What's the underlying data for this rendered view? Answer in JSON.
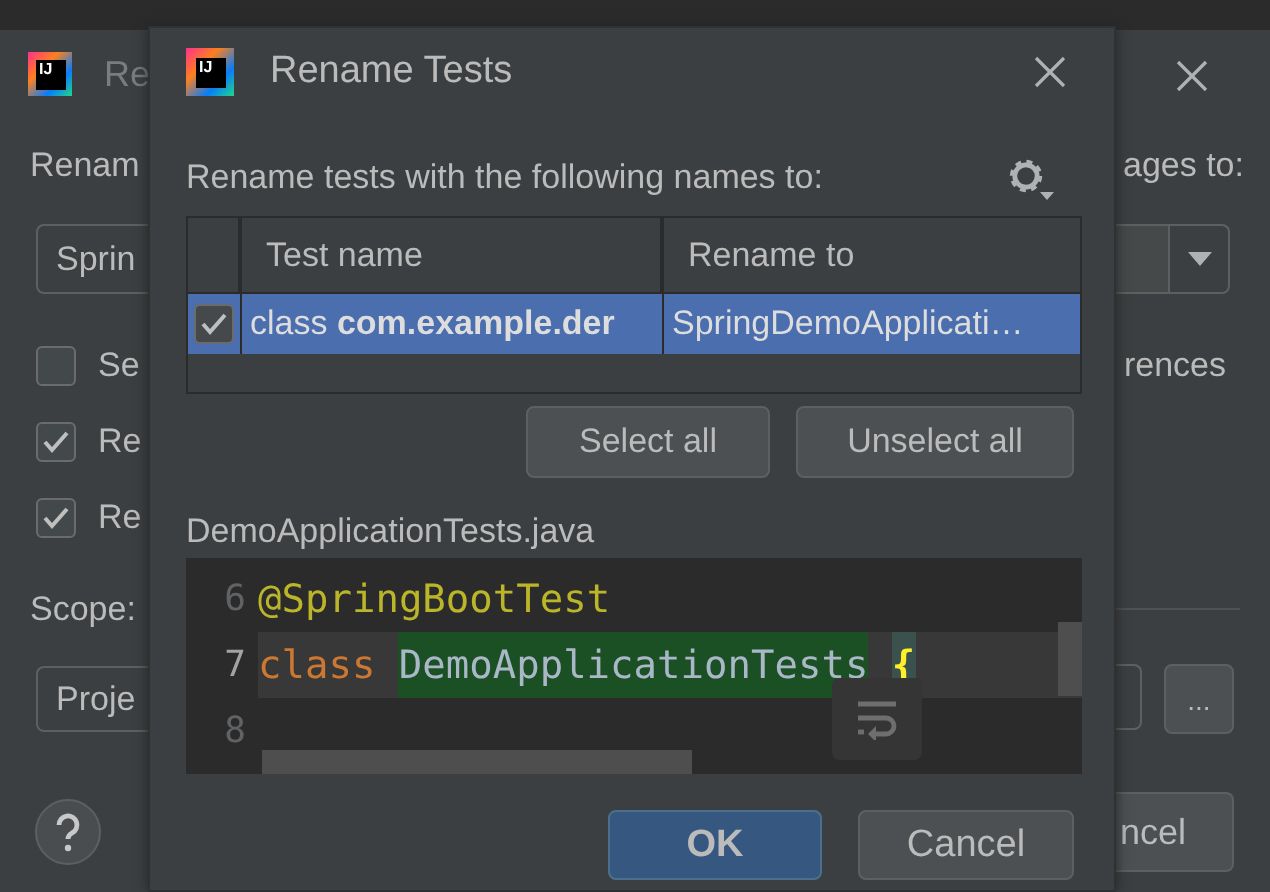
{
  "background_dialog": {
    "logo": "IJ",
    "title": "Re",
    "prompt": "Renam",
    "prompt_end": "ages to:",
    "name_field": {
      "value": "Sprin"
    },
    "options": [
      {
        "label": "Se",
        "checked": false
      },
      {
        "label": "Re",
        "checked": true
      },
      {
        "label": "Re",
        "checked": true
      }
    ],
    "option_end": "rences",
    "scope_label": "Scope:",
    "scope_field": {
      "value": "Proje"
    },
    "more_button": "...",
    "cancel_button": "ncel"
  },
  "dialog": {
    "logo": "IJ",
    "title": "Rename Tests",
    "prompt": "Rename tests with the following names to:",
    "table": {
      "columns": [
        "Test name",
        "Rename to"
      ],
      "rows": [
        {
          "checked": true,
          "selected": true,
          "test_name": "class **com.example.der**",
          "rename_to": "SpringDemoApplicati…"
        }
      ]
    },
    "buttons": [
      "Select all",
      "Unselect all"
    ],
    "file_name": "DemoApplicationTests.java",
    "code_lines": [
      {
        "number": "6",
        "current": false,
        "tokens": [
          {
            "kind": "annotation",
            "text": "@SpringBootTest"
          }
        ]
      },
      {
        "number": "7",
        "current": true,
        "tokens": [
          {
            "kind": "keyword",
            "text": "class"
          },
          {
            "kind": "highlight",
            "text": "DemoApplicationTests"
          },
          {
            "kind": "brace",
            "text": "{"
          }
        ]
      },
      {
        "number": "8",
        "current": false
      }
    ],
    "ok_button": "OK",
    "cancel_button": "Cancel"
  }
}
